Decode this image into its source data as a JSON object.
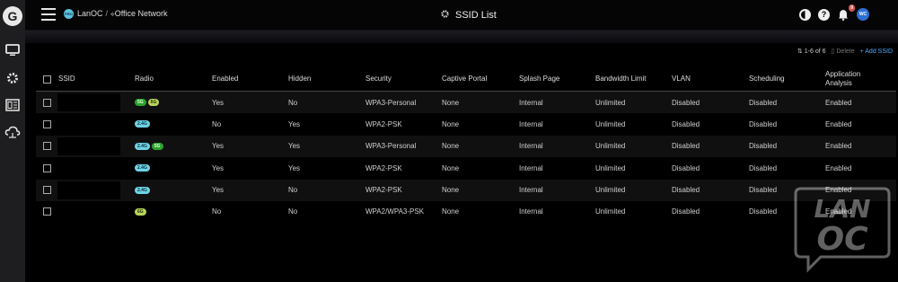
{
  "header": {
    "pro_badge": "PRO",
    "breadcrumb_site": "LanOC",
    "breadcrumb_sep": "/",
    "breadcrumb_network": "Office Network",
    "page_title": "SSID List",
    "notification_count": "9",
    "avatar_initials": "WC"
  },
  "toolbar": {
    "pager": "1-6 of 6",
    "delete_label": "Delete",
    "add_label": "+ Add SSID"
  },
  "table": {
    "columns": [
      "SSID",
      "Radio",
      "Enabled",
      "Hidden",
      "Security",
      "Captive Portal",
      "Splash Page",
      "Bandwidth Limit",
      "VLAN",
      "Scheduling",
      "Application Analysis"
    ],
    "rows": [
      {
        "radio": [
          "5G",
          "6G"
        ],
        "enabled": "Yes",
        "hidden": "No",
        "security": "WPA3-Personal",
        "captive": "None",
        "splash": "Internal",
        "bandwidth": "Unlimited",
        "vlan": "Disabled",
        "scheduling": "Disabled",
        "app": "Enabled"
      },
      {
        "radio": [
          "2.4G"
        ],
        "enabled": "No",
        "hidden": "Yes",
        "security": "WPA2-PSK",
        "captive": "None",
        "splash": "Internal",
        "bandwidth": "Unlimited",
        "vlan": "Disabled",
        "scheduling": "Disabled",
        "app": "Enabled"
      },
      {
        "radio": [
          "2.4G",
          "5G"
        ],
        "enabled": "Yes",
        "hidden": "Yes",
        "security": "WPA3-Personal",
        "captive": "None",
        "splash": "Internal",
        "bandwidth": "Unlimited",
        "vlan": "Disabled",
        "scheduling": "Disabled",
        "app": "Enabled"
      },
      {
        "radio": [
          "2.4G"
        ],
        "enabled": "Yes",
        "hidden": "Yes",
        "security": "WPA2-PSK",
        "captive": "None",
        "splash": "Internal",
        "bandwidth": "Unlimited",
        "vlan": "Disabled",
        "scheduling": "Disabled",
        "app": "Enabled"
      },
      {
        "radio": [
          "2.4G"
        ],
        "enabled": "Yes",
        "hidden": "No",
        "security": "WPA2-PSK",
        "captive": "None",
        "splash": "Internal",
        "bandwidth": "Unlimited",
        "vlan": "Disabled",
        "scheduling": "Disabled",
        "app": "Enabled"
      },
      {
        "radio": [
          "6G"
        ],
        "enabled": "No",
        "hidden": "No",
        "security": "WPA2/WPA3-PSK",
        "captive": "None",
        "splash": "Internal",
        "bandwidth": "Unlimited",
        "vlan": "Disabled",
        "scheduling": "Disabled",
        "app": "Enabled"
      }
    ]
  },
  "badge_colors": {
    "2.4G": "b24",
    "5G": "b5",
    "6G": "b6"
  },
  "watermark": {
    "line1": "LAN",
    "line2": "OC"
  },
  "icons": {
    "sidebar": [
      "monitor-icon",
      "gear-icon",
      "devices-list-icon",
      "cloud-network-icon"
    ],
    "header": [
      "hamburger-icon",
      "theme-toggle-icon",
      "help-icon",
      "bell-icon"
    ]
  }
}
